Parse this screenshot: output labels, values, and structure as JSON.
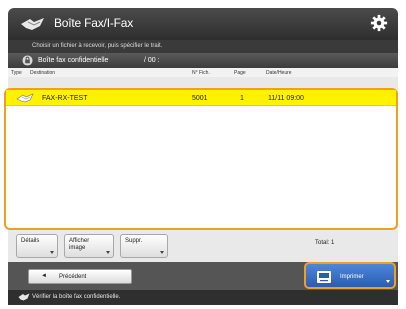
{
  "header": {
    "title": "Boîte Fax/I-Fax",
    "title_icon": "fax-icon",
    "settings_icon": "gear-icon"
  },
  "instruction": "Choisir un fichier à recevoir, puis spécifier le trait.",
  "box": {
    "name": "Boîte fax confidentielle",
    "number": "/ 00 :"
  },
  "columns": {
    "type": "Type",
    "destination": "Destination",
    "number": "N° Fich.",
    "pages": "Page",
    "datetime": "Date/Heure"
  },
  "rows": [
    {
      "type_icon": "fax-document-icon",
      "destination": "FAX-RX-TEST",
      "number": "5001",
      "pages": "1",
      "datetime": "11/11 09:00"
    }
  ],
  "actions": {
    "details": "Détails",
    "show_image_line1": "Afficher",
    "show_image_line2": "image",
    "delete": "Suppr.",
    "total": "Total: 1"
  },
  "nav": {
    "prev_label": "Précédent",
    "prev_arrow": "◄",
    "print_label": "Imprimer"
  },
  "status": "Vérifier la boîte fax confidentielle."
}
